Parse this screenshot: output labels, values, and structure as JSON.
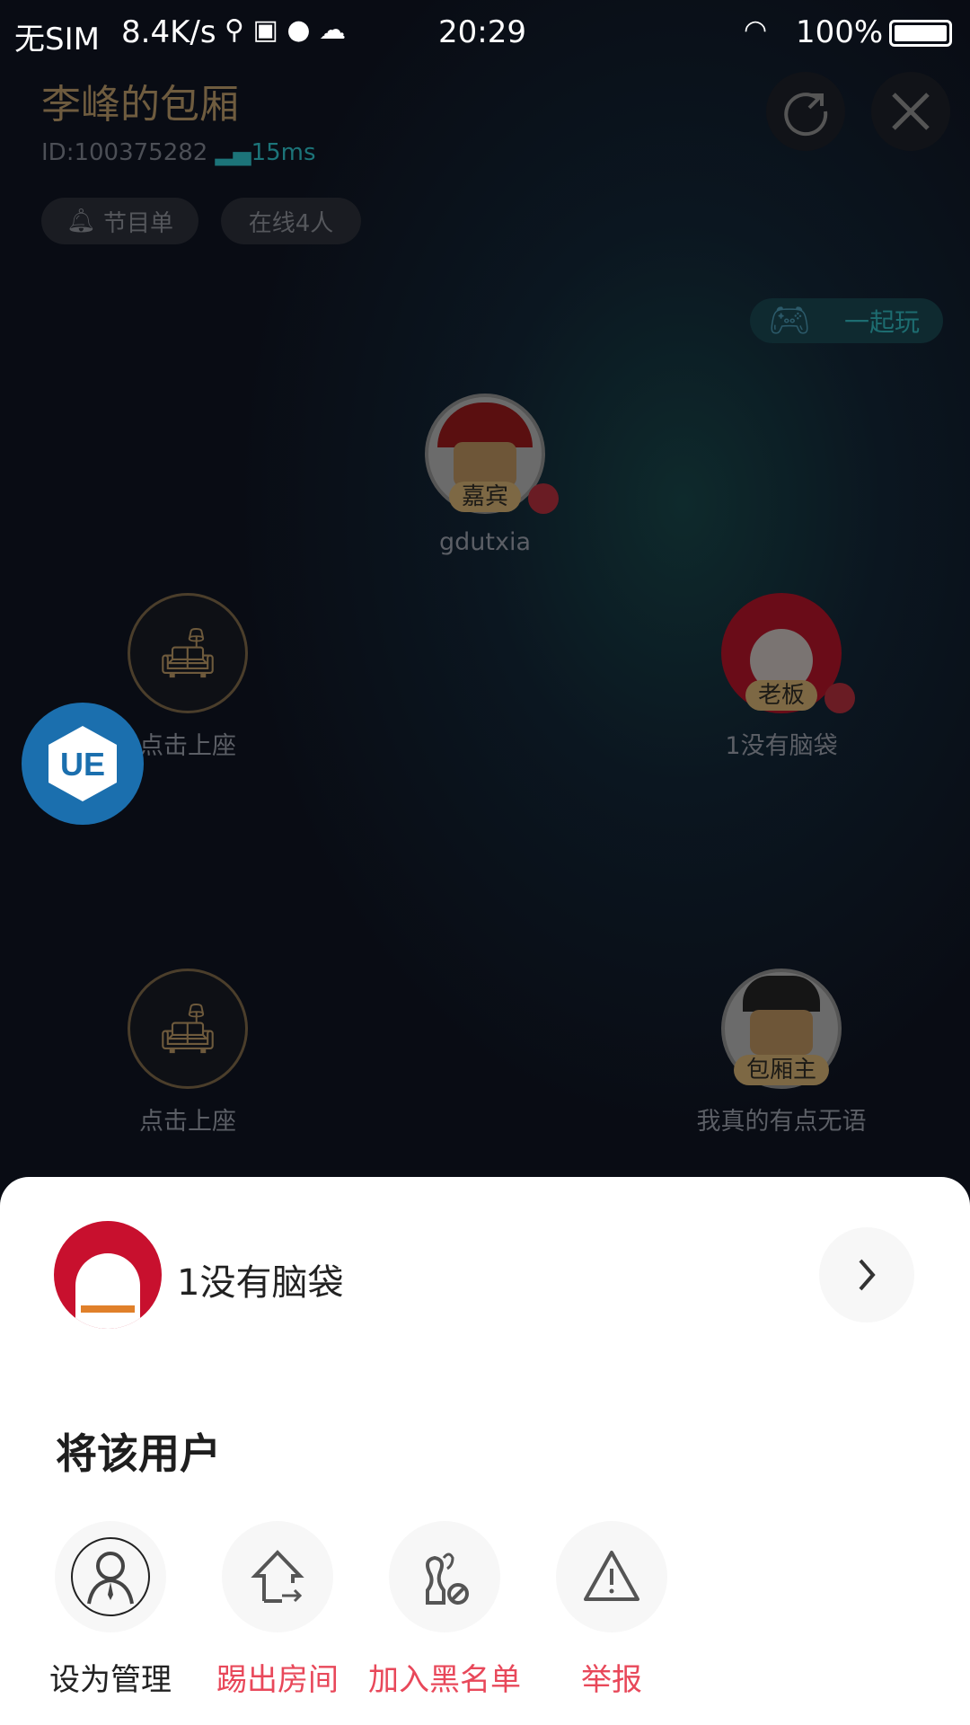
{
  "status_bar": {
    "carrier": "无SIM",
    "speed": "8.4K/s",
    "time": "20:29",
    "battery": "100%"
  },
  "room": {
    "title": "李峰的包厢",
    "id": "ID:100375282",
    "latency": "15ms",
    "program_chip": "节目单",
    "online_chip": "在线4人",
    "play_together": "一起玩"
  },
  "seats": [
    {
      "badge": "嘉宾",
      "name": "gdutxia",
      "muted": true
    },
    {
      "name": "点击上座",
      "empty": true
    },
    {
      "badge": "老板",
      "name": "1没有脑袋",
      "muted": true
    },
    {
      "name": "点击上座",
      "empty": true
    },
    {
      "badge": "包厢主",
      "name": "我真的有点无语"
    }
  ],
  "floating": {
    "label": "UE"
  },
  "sheet": {
    "username": "1没有脑袋",
    "section_title": "将该用户",
    "actions": [
      {
        "label": "设为管理",
        "icon": "admin-icon"
      },
      {
        "label": "踢出房间",
        "icon": "kick-out-icon"
      },
      {
        "label": "加入黑名单",
        "icon": "blacklist-icon"
      },
      {
        "label": "举报",
        "icon": "warning-icon"
      }
    ]
  },
  "colors": {
    "accent_red": "#e8485a",
    "ue_blue": "#1b6fae",
    "latency_teal": "#1c7479"
  }
}
